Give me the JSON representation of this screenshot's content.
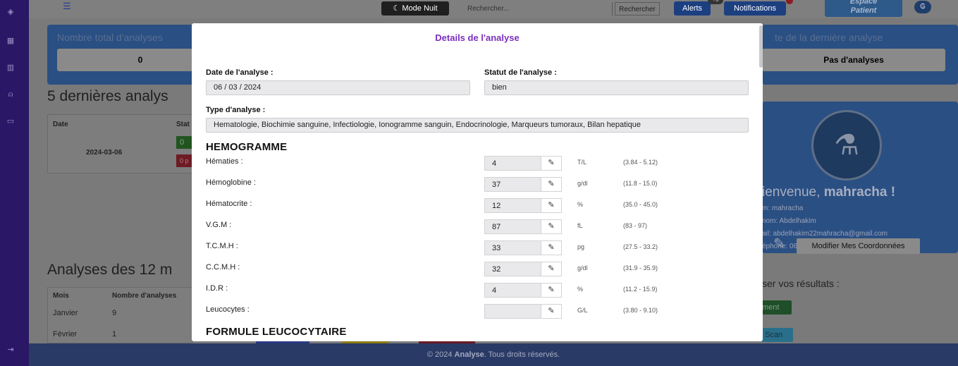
{
  "topbar": {
    "mode_nuit": "Mode Nuit",
    "search_placeholder": "Rechercher...",
    "search_button": "Rechercher",
    "alerts": "Alerts",
    "alerts_badge": "+3",
    "notifications": "Notifications",
    "espace_patient_line1": "Espace",
    "espace_patient_line2": "Patient"
  },
  "dashboard": {
    "total_label": "Nombre total d'analyses",
    "total_value": "0",
    "last_label": "te de la dernière analyse",
    "last_value": "Pas d'analyses",
    "recent_title": "5 dernières analys",
    "recent_table": {
      "col_date": "Date",
      "col_status": "Stat",
      "row_date": "2024-03-06",
      "badge1": "0",
      "badge2": "0 p"
    },
    "months_title": "Analyses des 12 m",
    "months_table": {
      "col_month": "Mois",
      "col_count": "Nombre d'analyses",
      "rows": [
        {
          "month": "Janvier",
          "count": "9"
        },
        {
          "month": "Février",
          "count": "1"
        }
      ]
    }
  },
  "profile": {
    "welcome": "ienvenue, ",
    "username": "mahracha !",
    "name_line": "m: mahracha",
    "prenom_line": "nom: Abdelhakim",
    "email_line": "ail: abdelhakim22mahracha@gmail.com",
    "phone_line": "éphone: 0656545789",
    "modify_button": "Modifier Mes Coordonnées",
    "upload_title": "ser vos résultats :",
    "upload_button": "ment",
    "scan_button": "Scan"
  },
  "modal": {
    "title": "Details de l'analyse",
    "date_label": "Date de l'analyse :",
    "date_value": "06 / 03 / 2024",
    "status_label": "Statut de l'analyse :",
    "status_value": "bien",
    "type_label": "Type d'analyse :",
    "type_value": "Hematologie, Biochimie sanguine, Infectiologie, Ionogramme sanguin, Endocrinologie, Marqueurs tumoraux, Bilan hepatique",
    "section1": "HEMOGRAMME",
    "section2": "FORMULE LEUCOCYTAIRE",
    "rows": [
      {
        "label": "Hématies :",
        "value": "4",
        "unit": "T/L",
        "range": "(3.84 - 5.12)"
      },
      {
        "label": "Hémoglobine :",
        "value": "37",
        "unit": "g/dl",
        "range": "(11.8 - 15.0)"
      },
      {
        "label": "Hématocrite :",
        "value": "12",
        "unit": "%",
        "range": "(35.0 - 45.0)"
      },
      {
        "label": "V.G.M :",
        "value": "87",
        "unit": "fL",
        "range": "(83 - 97)"
      },
      {
        "label": "T.C.M.H :",
        "value": "33",
        "unit": "pg",
        "range": "(27.5 - 33.2)"
      },
      {
        "label": "C.C.M.H :",
        "value": "32",
        "unit": "g/dl",
        "range": "(31.9 - 35.9)"
      },
      {
        "label": "I.D.R :",
        "value": "4",
        "unit": "%",
        "range": "(11.2 - 15.9)"
      },
      {
        "label": "Leucocytes :",
        "value": "",
        "unit": "G/L",
        "range": "(3.80 - 9.10)"
      }
    ]
  },
  "footer": {
    "prefix": "© 2024 ",
    "brand": "Analyse",
    "suffix": ". Tous droits réservés."
  }
}
